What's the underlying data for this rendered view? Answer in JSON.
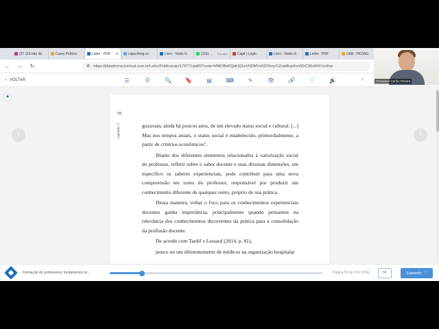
{
  "browser": {
    "tabs": [
      {
        "label": "(37.115 não lid",
        "color": "#b03a8a",
        "active": false,
        "close": ""
      },
      {
        "label": "Curso Político",
        "color": "#e8a33a",
        "active": false,
        "close": ""
      },
      {
        "label": "Leitor - PDF",
        "color": "#1f6fb8",
        "active": true,
        "close": "✕"
      },
      {
        "label": "capa.thmg.co",
        "color": "#6fa3d8",
        "active": false,
        "close": ""
      },
      {
        "label": "Livro - Visão G",
        "color": "#1f6fb8",
        "active": false,
        "close": ""
      },
      {
        "label": "(116) WhatsAp",
        "sub": "Som ativo",
        "color": "#25d366",
        "active": false,
        "close": ""
      },
      {
        "label": "Cajal | Login",
        "color": "#d33a3a",
        "active": false,
        "close": ""
      },
      {
        "label": "Livro - Visão G",
        "color": "#1f6fb8",
        "active": false,
        "close": ""
      },
      {
        "label": "Leitor - PDF",
        "color": "#1f6fb8",
        "active": false,
        "close": ""
      },
      {
        "label": "UAB - PEDAG",
        "color": "#e8a33a",
        "active": false,
        "close": ""
      }
    ],
    "url": "https://plataforma.bvirtual.com.br/Leitor/Publicacao/179771/pdf/0?code=MMOBsRQsKiQ1eVNDMVx0ZDSnyJ1ZrakBxjsKoVEhC99sW4Yzz9Ias"
  },
  "reader": {
    "back_label": "VOLTAR",
    "tools": [
      "☰",
      "⎙",
      "🔍",
      "🔖",
      "▤",
      "⌨",
      "✎",
      "👁",
      "🔗",
      "📄",
      "🔊"
    ],
    "tool_names": [
      "toc-icon",
      "print-icon",
      "zoom-icon",
      "bookmark-icon",
      "notes-icon",
      "keyboard-icon",
      "pen-icon",
      "eye-icon",
      "link-icon",
      "document-icon",
      "audio-icon"
    ],
    "search_glyph": "⌕",
    "star_glyph": "★",
    "prev_glyph": "‹",
    "next_glyph": "›"
  },
  "webcam": {
    "name": "Cleverson Carlos Pereira"
  },
  "page": {
    "number": "56",
    "side_label": "capítulo 3",
    "paragraphs": [
      {
        "text": "gozavam, ainda há poucos anos, de um elevado status social e cultural. [...] Mas nos tempos atuais, o status social é estabelecido, primordialmente, a partir de critérios econômicos\".",
        "indent": false
      },
      {
        "text": "Diante dos diferentes elementos relacionados à valorização social do professor, refletir sobre o saber docente e suas diversas dimensões, em específico os saberes experienciais, pode contribuir para uma nova compreensão em torno do professor, responsável por produzir um conhecimento diferente de qualquer outro, próprio de sua prática.",
        "indent": true
      },
      {
        "text": "Dessa maneira, voltar o foco para os conhecimentos experienciais docentes ganha importância, principalmente quando pensamos na relevância dos conhecimentos decorrentes da prática para a consolidação da profissão docente.",
        "indent": true
      },
      {
        "text": "De acordo com Tardif e Lessard (2014, p. 81),",
        "indent": true
      },
      {
        "text": "pouco ou um diferentemente de médicos na organização hospitalar",
        "indent": true
      }
    ]
  },
  "footer": {
    "book_title": "Formação de professores: fundamentos te...",
    "progress": 0.15,
    "page_info": "Página 56 de 374 (15%)",
    "page_box": "56",
    "expand_label": "Expandir",
    "expand_icon": "⛶"
  }
}
